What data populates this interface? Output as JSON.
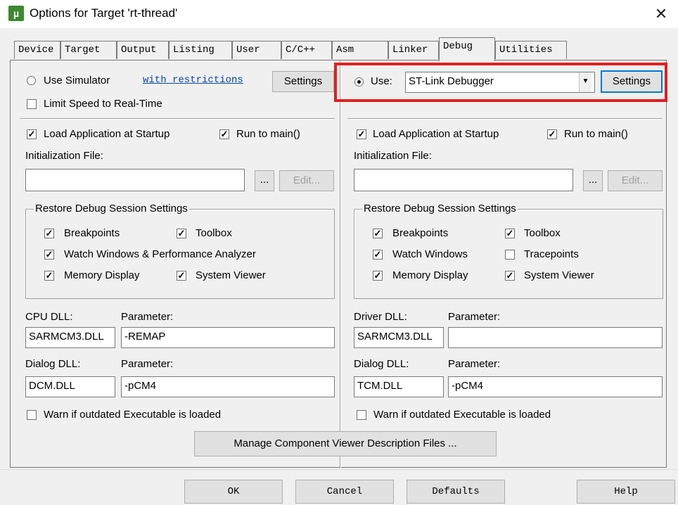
{
  "window": {
    "title": "Options for Target 'rt-thread'",
    "app_icon_text": "µ"
  },
  "tabs": [
    {
      "label": "Device"
    },
    {
      "label": "Target"
    },
    {
      "label": "Output"
    },
    {
      "label": "Listing"
    },
    {
      "label": "User"
    },
    {
      "label": "C/C++"
    },
    {
      "label": "Asm"
    },
    {
      "label": "Linker"
    },
    {
      "label": "Debug",
      "active": true
    },
    {
      "label": "Utilities"
    }
  ],
  "left": {
    "use_simulator_label": "Use Simulator",
    "restrictions_link": "with restrictions",
    "settings_label": "Settings",
    "limit_speed_label": "Limit Speed to Real-Time",
    "load_app_label": "Load Application at Startup",
    "run_to_main_label": "Run to main()",
    "init_file_label": "Initialization File:",
    "init_file_value": "",
    "browse_label": "...",
    "edit_label": "Edit...",
    "restore_group_title": "Restore Debug Session Settings",
    "breakpoints_label": "Breakpoints",
    "toolbox_label": "Toolbox",
    "watch_label": "Watch Windows & Performance Analyzer",
    "memory_label": "Memory Display",
    "sysviewer_label": "System Viewer",
    "cpu_dll_label": "CPU DLL:",
    "cpu_param_label": "Parameter:",
    "cpu_dll_value": "SARMCM3.DLL",
    "cpu_param_value": "-REMAP",
    "dialog_dll_label": "Dialog DLL:",
    "dialog_param_label": "Parameter:",
    "dialog_dll_value": "DCM.DLL",
    "dialog_param_value": "-pCM4",
    "warn_label": "Warn if outdated Executable is loaded"
  },
  "right": {
    "use_label": "Use:",
    "debugger_value": "ST-Link Debugger",
    "settings_label": "Settings",
    "load_app_label": "Load Application at Startup",
    "run_to_main_label": "Run to main()",
    "init_file_label": "Initialization File:",
    "init_file_value": "",
    "browse_label": "...",
    "edit_label": "Edit...",
    "restore_group_title": "Restore Debug Session Settings",
    "breakpoints_label": "Breakpoints",
    "toolbox_label": "Toolbox",
    "watch_label": "Watch Windows",
    "tracepoints_label": "Tracepoints",
    "memory_label": "Memory Display",
    "sysviewer_label": "System Viewer",
    "driver_dll_label": "Driver DLL:",
    "driver_param_label": "Parameter:",
    "driver_dll_value": "SARMCM3.DLL",
    "driver_param_value": "",
    "dialog_dll_label": "Dialog DLL:",
    "dialog_param_label": "Parameter:",
    "dialog_dll_value": "TCM.DLL",
    "dialog_param_value": "-pCM4",
    "warn_label": "Warn if outdated Executable is loaded"
  },
  "manage_button_label": "Manage Component Viewer Description Files ...",
  "footer": {
    "ok": "OK",
    "cancel": "Cancel",
    "defaults": "Defaults",
    "help": "Help"
  },
  "state": {
    "use_simulator": false,
    "use_debugger": true,
    "left_limit_speed": false,
    "left_load_app": true,
    "left_run_to_main": true,
    "left_breakpoints": true,
    "left_toolbox": true,
    "left_watch": true,
    "left_memory": true,
    "left_sysviewer": true,
    "left_warn": false,
    "right_load_app": true,
    "right_run_to_main": true,
    "right_breakpoints": true,
    "right_toolbox": true,
    "right_watch": true,
    "right_tracepoints": false,
    "right_memory": true,
    "right_sysviewer": true,
    "right_warn": false
  },
  "colors": {
    "highlight": "#e02020",
    "link": "#0645ad",
    "dialog_bg": "#f0f0f0"
  }
}
